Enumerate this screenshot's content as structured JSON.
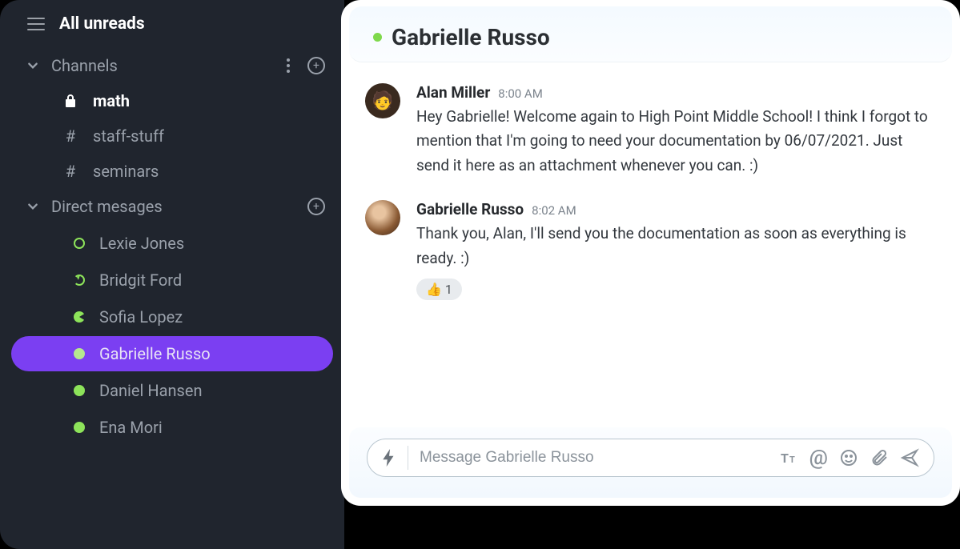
{
  "sidebar": {
    "title": "All unreads",
    "channels_label": "Channels",
    "dms_label": "Direct mesages",
    "channels": [
      {
        "name": "math",
        "icon": "lock",
        "active": true
      },
      {
        "name": "staff-stuff",
        "icon": "hash",
        "active": false
      },
      {
        "name": "seminars",
        "icon": "hash",
        "active": false
      }
    ],
    "dms": [
      {
        "name": "Lexie Jones",
        "status": "outline",
        "selected": false
      },
      {
        "name": "Bridgit Ford",
        "status": "refresh",
        "selected": false
      },
      {
        "name": "Sofia Lopez",
        "status": "pac",
        "selected": false
      },
      {
        "name": "Gabrielle Russo",
        "status": "online",
        "selected": true
      },
      {
        "name": "Daniel Hansen",
        "status": "online",
        "selected": false
      },
      {
        "name": "Ena Mori",
        "status": "online",
        "selected": false
      }
    ]
  },
  "conversation": {
    "title": "Gabrielle Russo",
    "presence": "online",
    "composer_placeholder": "Message Gabrielle Russo",
    "messages": [
      {
        "sender": "Alan Miller",
        "timestamp": "8:00 AM",
        "text": "Hey Gabrielle! Welcome again to High Point Middle School! I think I forgot to mention that I'm going to need your documentation by 06/07/2021. Just send it here as an attachment whenever you can. :)",
        "reactions": []
      },
      {
        "sender": "Gabrielle Russo",
        "timestamp": "8:02 AM",
        "text": "Thank you, Alan, I'll send you the documentation as soon as everything is ready. :)",
        "reactions": [
          {
            "emoji": "👍",
            "count": "1"
          }
        ]
      }
    ]
  },
  "colors": {
    "sidebar_bg": "#20252e",
    "accent_purple": "#7b3ff2",
    "accent_green": "#8de35a"
  }
}
